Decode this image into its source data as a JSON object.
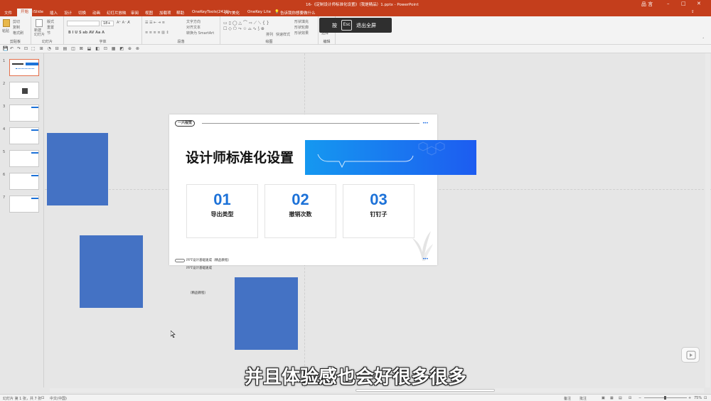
{
  "app": {
    "window_title": "16-《定制设计师标准化设置》（我是精品）1.pptx - PowerPoint",
    "user": "品 言"
  },
  "menu": {
    "items": [
      "文件",
      "开始",
      "iSlide",
      "插入",
      "设计",
      "切换",
      "动画",
      "幻灯片放映",
      "审阅",
      "视图",
      "加载项",
      "帮助",
      "OneKeyTools(2429)",
      "PPT美化",
      "OneKey Lite"
    ],
    "active": "开始",
    "tell_me": "告诉我你想要做什么"
  },
  "ribbon": {
    "groups": [
      "剪贴板",
      "幻灯片",
      "字体",
      "段落",
      "绘图",
      "编辑"
    ],
    "paste": "粘贴",
    "clipboard_items": [
      "剪切",
      "复制",
      "格式刷"
    ],
    "new_slide": "新建\n幻灯片",
    "slide_items": [
      "版式",
      "重置",
      "节"
    ],
    "font_size": "18+",
    "para_items": [
      "文字方向",
      "对齐文本",
      "转换为 SmartArt"
    ],
    "arrange": "排列",
    "quick_styles": "快速样式",
    "shape_items": [
      "形状填充",
      "形状轮廓",
      "形状效果"
    ],
    "edit_items": [
      "查找",
      "替换",
      "选择"
    ]
  },
  "thumbnails": [
    "1",
    "2",
    "3",
    "4",
    "5",
    "6",
    "7"
  ],
  "slide": {
    "logo": "一六视觉",
    "dots": "•••",
    "title": "设计师标准化设置",
    "cards": [
      {
        "num": "01",
        "label": "导出类型"
      },
      {
        "num": "02",
        "label": "撤销次数"
      },
      {
        "num": "03",
        "label": "钉钉子"
      }
    ],
    "footer": "PPT设计基础速成（精品教程）",
    "footer_dots": "•••"
  },
  "floating_text": {
    "line1": "PPT设计基础速成",
    "line2": "（精品教程）"
  },
  "esc_overlay": {
    "press": "按",
    "key": "Esc",
    "action": "退出全屏"
  },
  "subtitle": "并且体验感也会好很多很多",
  "status": {
    "slide_info": "幻灯片 第 1 张，共 7 张",
    "language": "中文(中国)",
    "notes": "备注",
    "comments": "批注",
    "zoom": "75%"
  },
  "colors": {
    "accent": "#c43e1c",
    "shape_blue": "#4472c4",
    "slide_blue": "#1d72d8"
  }
}
